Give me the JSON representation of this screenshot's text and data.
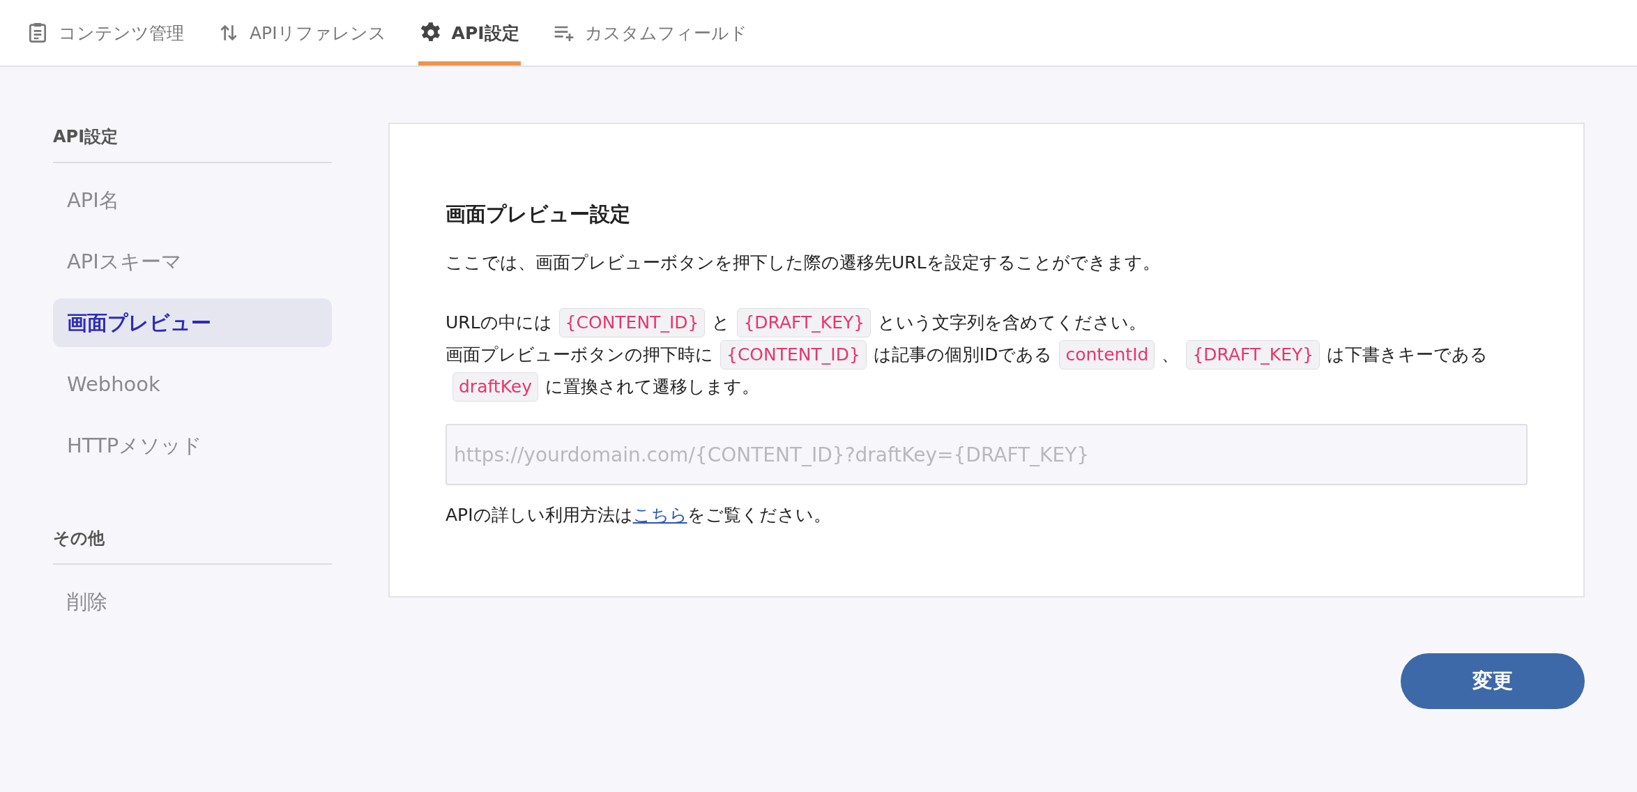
{
  "tabs": [
    {
      "label": "コンテンツ管理",
      "selected": false
    },
    {
      "label": "APIリファレンス",
      "selected": false
    },
    {
      "label": "API設定",
      "selected": true
    },
    {
      "label": "カスタムフィールド",
      "selected": false
    }
  ],
  "sidebar": {
    "sections": [
      {
        "heading": "API設定",
        "items": [
          {
            "label": "API名",
            "selected": false
          },
          {
            "label": "APIスキーマ",
            "selected": false
          },
          {
            "label": "画面プレビュー",
            "selected": true
          },
          {
            "label": "Webhook",
            "selected": false
          },
          {
            "label": "HTTPメソッド",
            "selected": false
          }
        ]
      },
      {
        "heading": "その他",
        "items": [
          {
            "label": "削除",
            "selected": false
          }
        ]
      }
    ]
  },
  "panel": {
    "title": "画面プレビュー設定",
    "intro": "ここでは、画面プレビューボタンを押下した際の遷移先URLを設定することができます。",
    "sentences": [
      [
        {
          "kind": "text",
          "text": "URLの中には"
        },
        {
          "kind": "code",
          "text": "{CONTENT_ID}"
        },
        {
          "kind": "text",
          "text": "と"
        },
        {
          "kind": "code",
          "text": "{DRAFT_KEY}"
        },
        {
          "kind": "text",
          "text": "という文字列を含めてください。"
        }
      ],
      [
        {
          "kind": "text",
          "text": "画面プレビューボタンの押下時に"
        },
        {
          "kind": "code",
          "text": "{CONTENT_ID}"
        },
        {
          "kind": "text",
          "text": "は記事の個別IDである"
        },
        {
          "kind": "code",
          "text": "contentId"
        },
        {
          "kind": "text",
          "text": "、"
        },
        {
          "kind": "code",
          "text": "{DRAFT_KEY}"
        },
        {
          "kind": "text",
          "text": "は下書きキーである"
        },
        {
          "kind": "code",
          "text": "draftKey"
        },
        {
          "kind": "text",
          "text": "に置換されて遷移します。"
        }
      ]
    ],
    "url_field": {
      "placeholder": "https://yourdomain.com/{CONTENT_ID}?draftKey={DRAFT_KEY}"
    },
    "help": [
      {
        "kind": "text",
        "text": "APIの詳しい利用方法は"
      },
      {
        "kind": "link",
        "text": "こちら"
      },
      {
        "kind": "text",
        "text": "をご覧ください。"
      }
    ]
  },
  "submit_button": "変更"
}
